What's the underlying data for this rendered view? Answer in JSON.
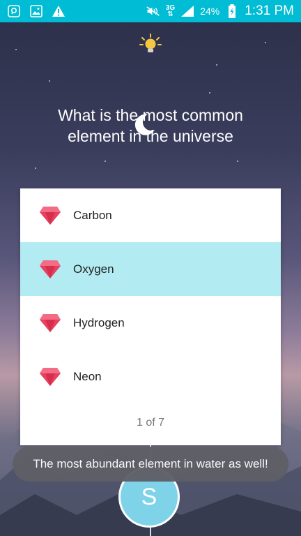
{
  "status_bar": {
    "battery": "24%",
    "time": "1:31 PM",
    "network_top": "3G",
    "network_bottom": "⇅",
    "icons": [
      "app-notification-icon",
      "gallery-icon",
      "warning-icon",
      "mute-icon",
      "signal-icon",
      "battery-charging-icon"
    ]
  },
  "quiz": {
    "hint_icon": "lightbulb-icon",
    "question": "What is the most common element in the universe",
    "options": [
      {
        "label": "Carbon",
        "icon": "gem-icon",
        "selected": false
      },
      {
        "label": "Oxygen",
        "icon": "gem-icon",
        "selected": true
      },
      {
        "label": "Hydrogen",
        "icon": "gem-icon",
        "selected": false
      },
      {
        "label": "Neon",
        "icon": "gem-icon",
        "selected": false
      }
    ],
    "progress": "1 of 7"
  },
  "toast": {
    "message": "The most abundant element in water as well!"
  },
  "avatar": {
    "initial": "S"
  },
  "colors": {
    "accent": "#00bcd4",
    "selected_row": "#b3ebf2",
    "avatar": "#7fd3e8",
    "gem": "#e8405e"
  }
}
